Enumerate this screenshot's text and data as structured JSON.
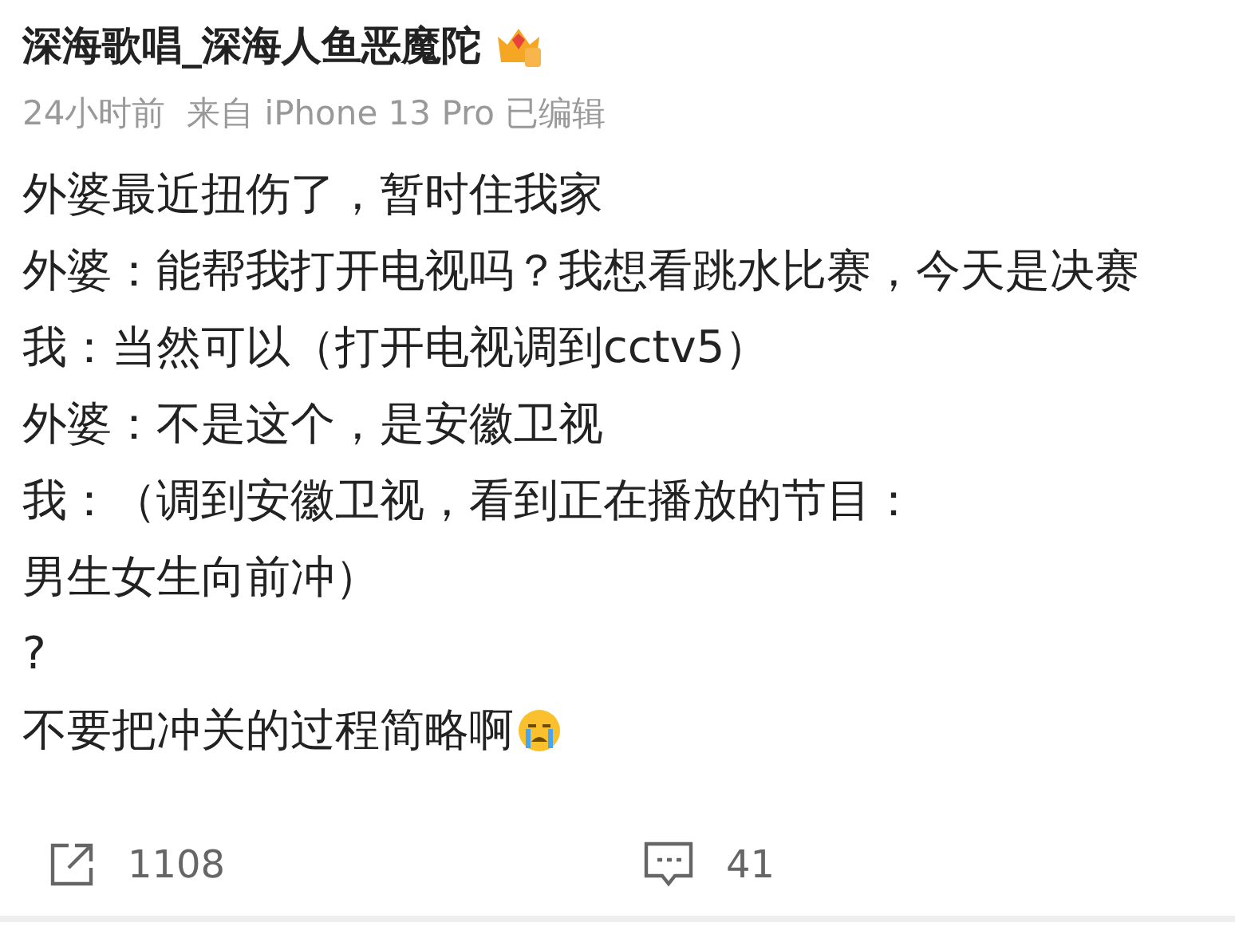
{
  "post": {
    "author": "深海歌唱_深海人鱼恶魔陀",
    "meta": "24小时前  来自 iPhone 13 Pro 已编辑",
    "lines": [
      {
        "text": "外婆最近扭伤了，暂时住我家"
      },
      {
        "text": "外婆：能帮我打开电视吗？我想看跳水比赛，今天是决赛"
      },
      {
        "text": "我：当然可以（打开电视调到cctv5）"
      },
      {
        "text": "外婆：不是这个，是安徽卫视"
      },
      {
        "text": "我：（调到安徽卫视，看到正在播放的节目："
      },
      {
        "text": "男生女生向前冲）"
      },
      {
        "text": "?"
      },
      {
        "text": "不要把冲关的过程简略啊",
        "kind": "emoji"
      }
    ]
  },
  "actions": [
    {
      "kind": "share",
      "count": "1108"
    },
    {
      "kind": "comment",
      "count": "41"
    }
  ]
}
